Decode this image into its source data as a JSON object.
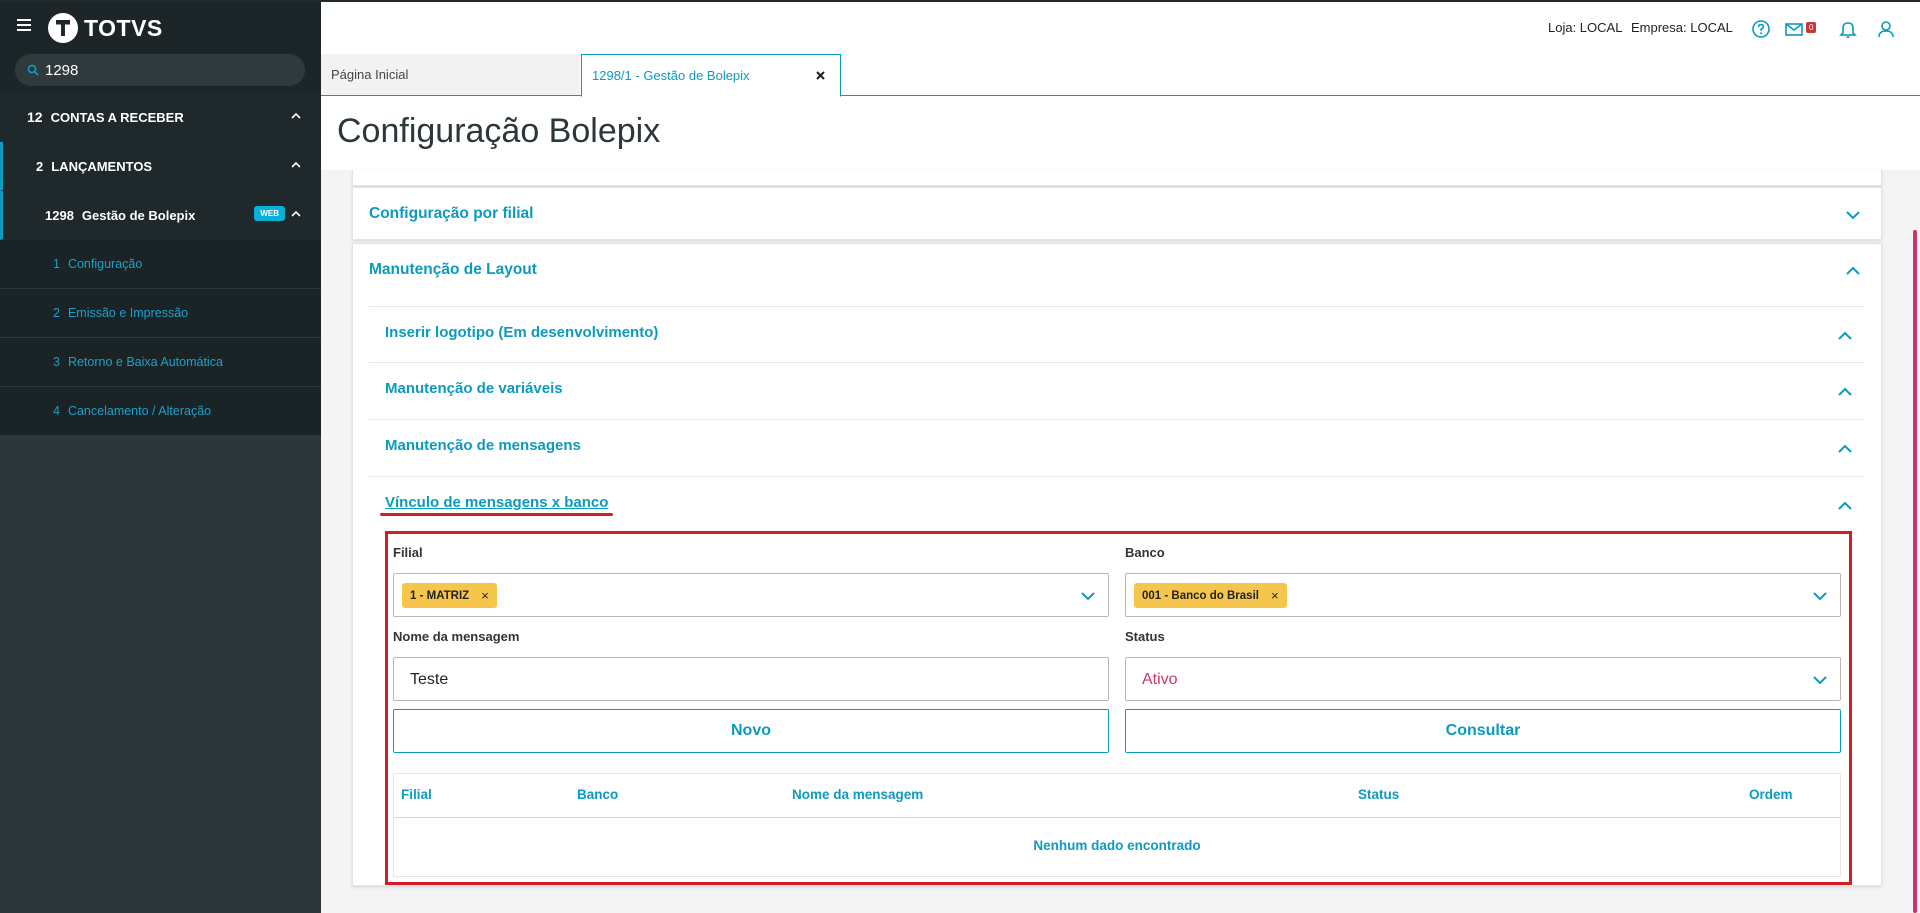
{
  "app": {
    "logo_text": "TOTVS",
    "search_value": "1298"
  },
  "sidebar": {
    "items": [
      {
        "num": "12",
        "label": "CONTAS A RECEBER"
      },
      {
        "num": "2",
        "label": "LANÇAMENTOS"
      },
      {
        "num": "1298",
        "label": "Gestão de Bolepix",
        "badge": "WEB"
      }
    ],
    "subitems": [
      {
        "num": "1",
        "label": "Configuração"
      },
      {
        "num": "2",
        "label": "Emissão e Impressão"
      },
      {
        "num": "3",
        "label": "Retorno e Baixa Automática"
      },
      {
        "num": "4",
        "label": "Cancelamento / Alteração"
      }
    ]
  },
  "topbar": {
    "loja": "Loja: LOCAL",
    "empresa": "Empresa: LOCAL",
    "mail_count": "0",
    "icons": [
      "help-icon",
      "mail-icon",
      "bell-icon",
      "user-icon"
    ]
  },
  "tabs": [
    {
      "label": "Página Inicial"
    },
    {
      "label": "1298/1 - Gestão de Bolepix"
    }
  ],
  "page": {
    "title": "Configuração Bolepix",
    "sections": {
      "filial": "Configuração por filial",
      "layout": "Manutenção de Layout",
      "inner": [
        "Inserir logotipo (Em desenvolvimento)",
        "Manutenção de variáveis",
        "Manutenção de mensagens",
        "Vínculo de mensagens x banco"
      ]
    }
  },
  "form": {
    "filial_label": "Filial",
    "filial_chip": "1 - MATRIZ",
    "banco_label": "Banco",
    "banco_chip": "001 - Banco do Brasil",
    "nome_label": "Nome da mensagem",
    "nome_value": "Teste",
    "status_label": "Status",
    "status_value": "Ativo",
    "novo_label": "Novo",
    "consultar_label": "Consultar"
  },
  "table": {
    "headers": [
      "Filial",
      "Banco",
      "Nome da mensagem",
      "Status",
      "Ordem"
    ],
    "empty_text": "Nenhum dado encontrado"
  },
  "colors": {
    "accent": "#0c9abe",
    "chip": "#f5c64b",
    "highlight": "#d31c24",
    "status_text": "#c9356f",
    "sidebar": "#2c3739"
  }
}
